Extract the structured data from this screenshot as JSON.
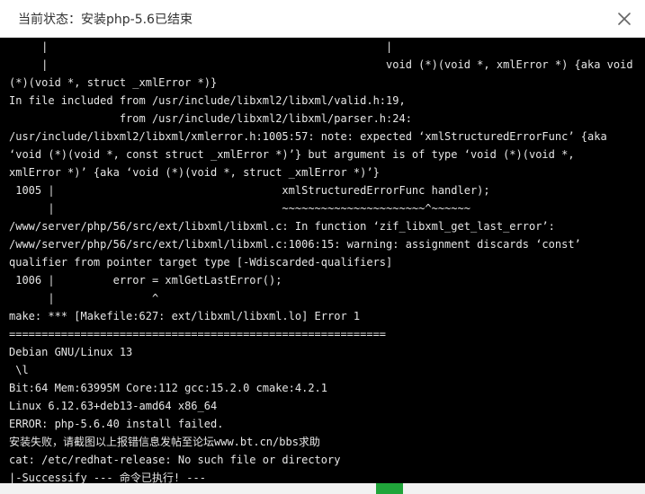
{
  "dialog": {
    "title": "当前状态：安装php-5.6已结束",
    "close_icon": "close-icon"
  },
  "colors": {
    "terminal_bg": "#000000",
    "terminal_text": "#e6e6e6",
    "title_text": "#333333",
    "accent": "#20a53a"
  },
  "terminal": {
    "lines": [
      "     |                                                    |",
      "     |                                                    void (*)(void *, xmlError *) {aka void",
      "(*)(void *, struct _xmlError *)}",
      "In file included from /usr/include/libxml2/libxml/valid.h:19,",
      "                 from /usr/include/libxml2/libxml/parser.h:24:",
      "/usr/include/libxml2/libxml/xmlerror.h:1005:57: note: expected ‘xmlStructuredErrorFunc’ {aka",
      "‘void (*)(void *, const struct _xmlError *)’} but argument is of type ‘void (*)(void *,",
      "xmlError *)’ {aka ‘void (*)(void *, struct _xmlError *)’}",
      " 1005 |                                   xmlStructuredErrorFunc handler);",
      "      |                                   ~~~~~~~~~~~~~~~~~~~~~~^~~~~~~",
      "/www/server/php/56/src/ext/libxml/libxml.c: In function ‘zif_libxml_get_last_error’:",
      "/www/server/php/56/src/ext/libxml/libxml.c:1006:15: warning: assignment discards ‘const’",
      "qualifier from pointer target type [-Wdiscarded-qualifiers]",
      " 1006 |         error = xmlGetLastError();",
      "      |               ^",
      "make: *** [Makefile:627: ext/libxml/libxml.lo] Error 1",
      "==========================================================",
      "Debian GNU/Linux 13",
      " \\l",
      "Bit:64 Mem:63995M Core:112 gcc:15.2.0 cmake:4.2.1",
      "Linux 6.12.63+deb13-amd64 x86_64",
      "ERROR: php-5.6.40 install failed.",
      "安装失败，请截图以上报错信息发帖至论坛www.bt.cn/bbs求助",
      "cat: /etc/redhat-release: No such file or directory",
      "|-Successify --- 命令已执行! ---"
    ]
  }
}
